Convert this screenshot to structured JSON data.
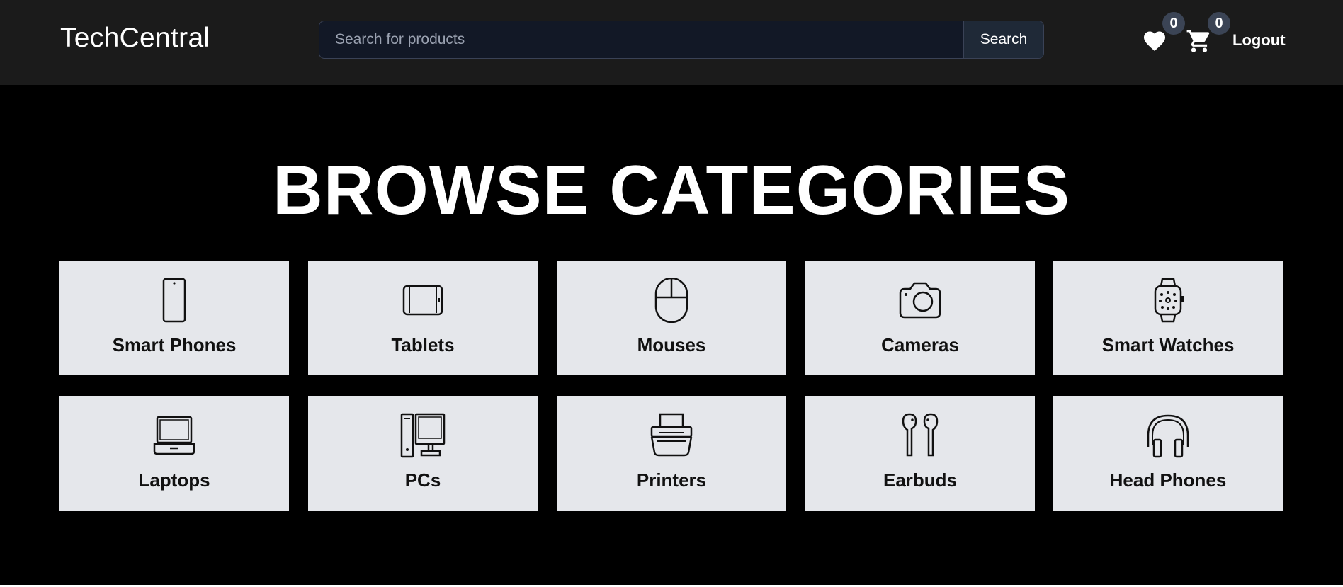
{
  "header": {
    "brand": "TechCentral",
    "search": {
      "placeholder": "Search for products",
      "value": "",
      "button_label": "Search"
    },
    "wishlist": {
      "icon": "heart-icon",
      "count": "0"
    },
    "cart": {
      "icon": "cart-icon",
      "count": "0"
    },
    "logout_label": "Logout"
  },
  "main": {
    "title": "BROWSE CATEGORIES",
    "categories": [
      {
        "label": "Smart Phones",
        "icon": "smartphone-icon"
      },
      {
        "label": "Tablets",
        "icon": "tablet-icon"
      },
      {
        "label": "Mouses",
        "icon": "mouse-icon"
      },
      {
        "label": "Cameras",
        "icon": "camera-icon"
      },
      {
        "label": "Smart Watches",
        "icon": "smartwatch-icon"
      },
      {
        "label": "Laptops",
        "icon": "laptop-icon"
      },
      {
        "label": "PCs",
        "icon": "desktop-pc-icon"
      },
      {
        "label": "Printers",
        "icon": "printer-icon"
      },
      {
        "label": "Earbuds",
        "icon": "earbuds-icon"
      },
      {
        "label": "Head Phones",
        "icon": "headphones-icon"
      }
    ]
  },
  "colors": {
    "header_bg": "#1b1b1b",
    "page_bg": "#000000",
    "card_bg": "#e5e7eb",
    "search_bg": "#121826",
    "badge_bg": "#3b4455"
  }
}
